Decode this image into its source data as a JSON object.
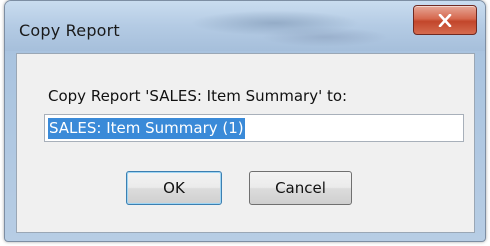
{
  "window": {
    "title": "Copy Report"
  },
  "dialog": {
    "prompt": "Copy Report 'SALES: Item Summary' to:",
    "name_value": "SALES: Item Summary (1)",
    "ok_label": "OK",
    "cancel_label": "Cancel"
  },
  "icons": {
    "close": "close-icon"
  },
  "colors": {
    "selection": "#3a8ad8",
    "close_button": "#c2462b",
    "title_bar": "#b4cbe4"
  }
}
